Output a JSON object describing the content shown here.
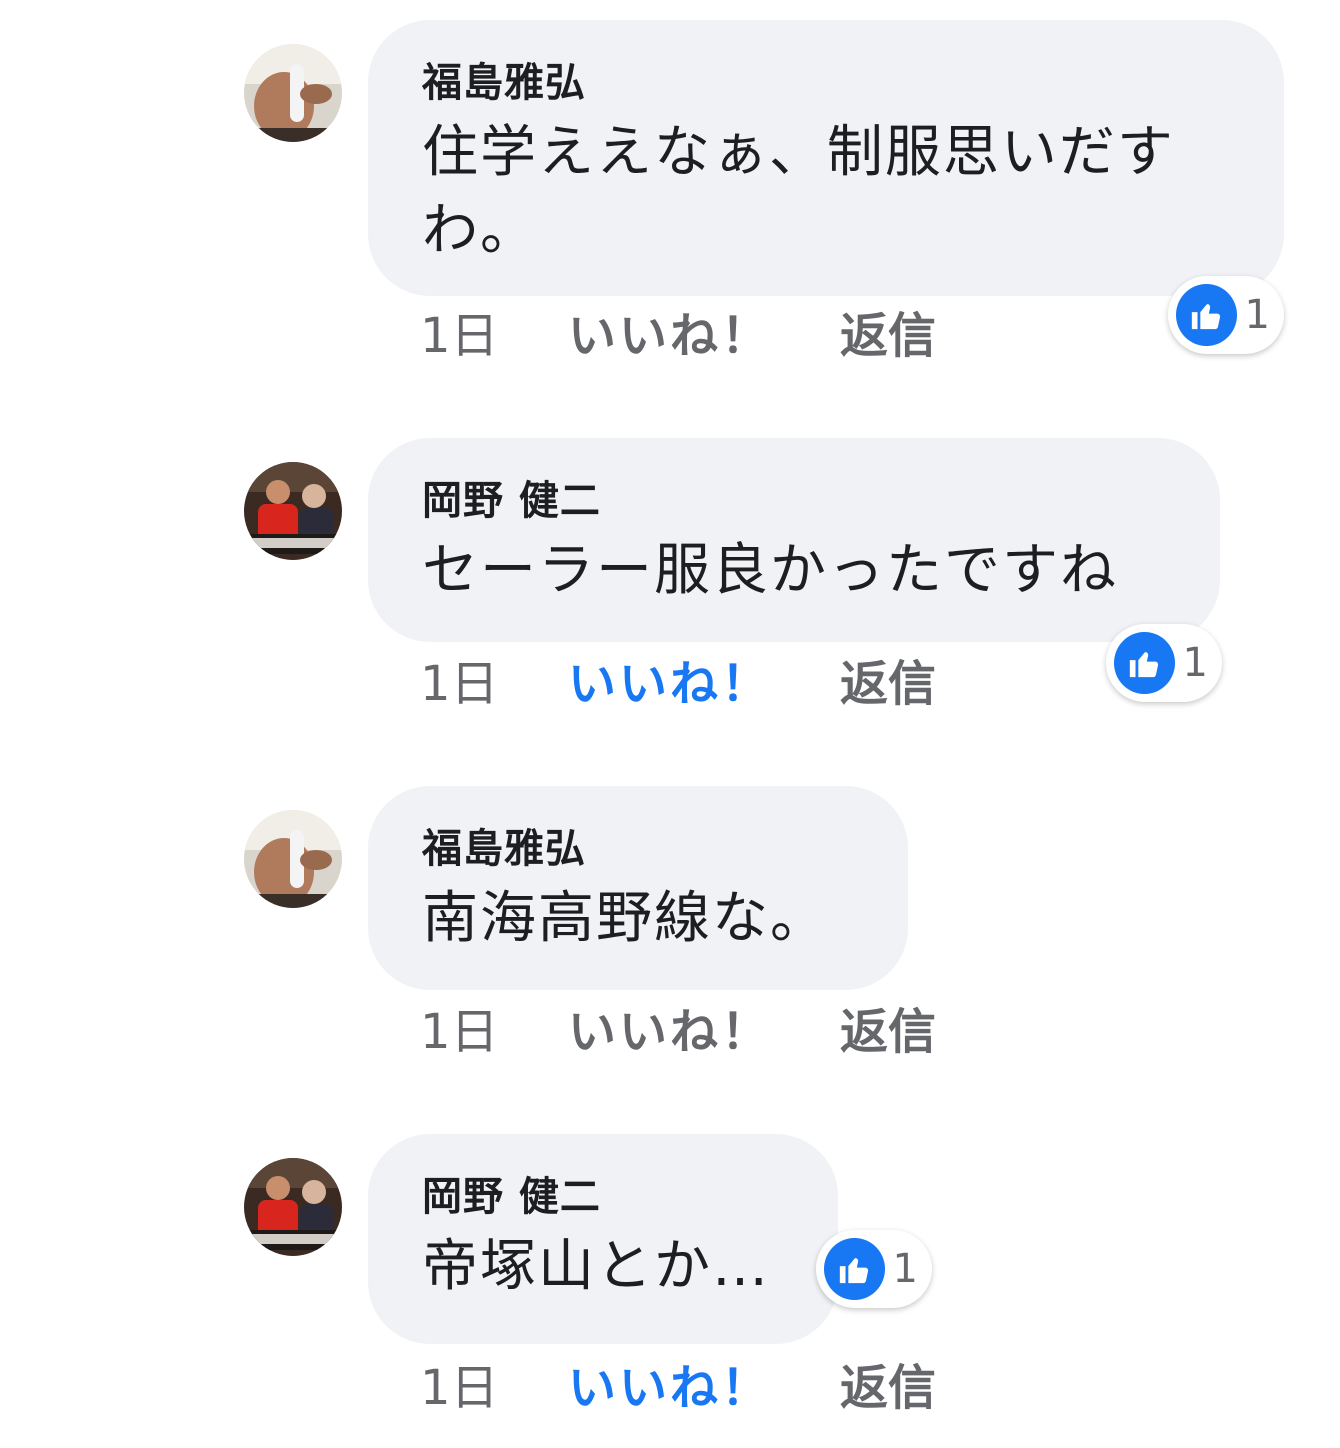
{
  "colors": {
    "accent": "#1877f2",
    "bubble": "#f0f2f5",
    "meta": "#65676b"
  },
  "comments": [
    {
      "author": "福島雅弘",
      "text": "住学ええなぁ、制服思いだす\nわ。",
      "time": "1日",
      "like": "いいね！",
      "reply": "返信",
      "liked": false,
      "reaction_icon": "like-icon",
      "reaction_count": "1"
    },
    {
      "author": "岡野 健二",
      "text": "セーラー服良かったですね",
      "time": "1日",
      "like": "いいね！",
      "reply": "返信",
      "liked": true,
      "reaction_icon": "like-icon",
      "reaction_count": "1"
    },
    {
      "author": "福島雅弘",
      "text": "南海高野線な。",
      "time": "1日",
      "like": "いいね！",
      "reply": "返信",
      "liked": false
    },
    {
      "author": "岡野 健二",
      "text": "帝塚山とか…",
      "time": "1日",
      "like": "いいね！",
      "reply": "返信",
      "liked": true,
      "reaction_icon": "like-icon",
      "reaction_count": "1"
    }
  ]
}
